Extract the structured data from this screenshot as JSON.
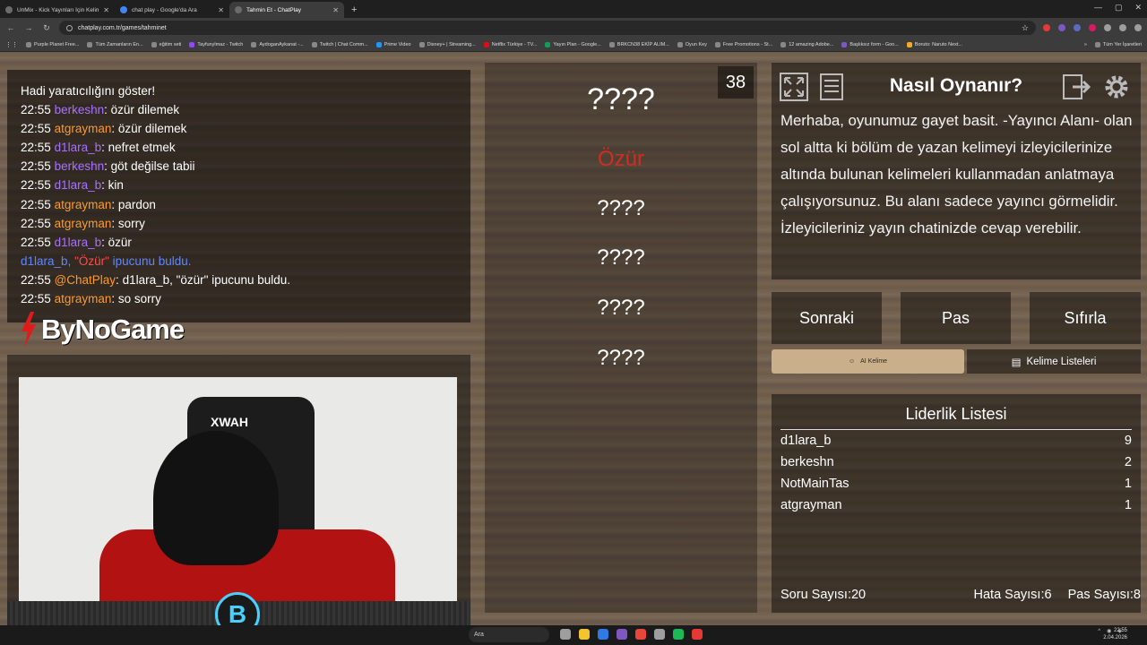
{
  "browser": {
    "tabs": [
      {
        "title": "UnMix - Kick Yayınları İçin Kelim",
        "active": false
      },
      {
        "title": "chat play - Google'da Ara",
        "active": false
      },
      {
        "title": "Tahmin Et - ChatPlay",
        "active": true
      }
    ],
    "url": "chatplay.com.tr/games/tahminet",
    "bookmarks": [
      "Purple Planet Free...",
      "Tüm Zamanların En...",
      "eğitim seti",
      "Tayfunylmaz - Twitch",
      "AydoganAykanat -...",
      "Twitch | Chat Comm...",
      "Prime Video",
      "Disney+ | Streaming...",
      "Netflix Türkiye - TV...",
      "Yayın Plan - Google...",
      "BRKCN38 EKİP ALIM...",
      "Oyun Key",
      "Free Promotions - St...",
      "12 amazing Adobe...",
      "Başlıksız form - Goo...",
      "Boruto: Naruto Next..."
    ],
    "all_bookmarks_label": "Tüm Yer İşaretleri"
  },
  "chat": {
    "lines": [
      {
        "time": "",
        "user": "",
        "sep": "",
        "text": "Hadi yaratıcılığını göster!",
        "user_color": "none",
        "type": "plain"
      },
      {
        "time": "22:55",
        "user": "berkeshn",
        "sep": ":",
        "text": "özür dilemek",
        "user_color": "purple",
        "type": "msg"
      },
      {
        "time": "22:55",
        "user": "atgrayman",
        "sep": ":",
        "text": "özür dilemek",
        "user_color": "orange",
        "type": "msg"
      },
      {
        "time": "22:55",
        "user": "d1lara_b",
        "sep": ":",
        "text": "nefret etmek",
        "user_color": "purple",
        "type": "msg"
      },
      {
        "time": "22:55",
        "user": "berkeshn",
        "sep": ":",
        "text": "göt değilse tabii",
        "user_color": "purple",
        "type": "msg"
      },
      {
        "time": "22:55",
        "user": "d1lara_b",
        "sep": ":",
        "text": "kin",
        "user_color": "purple",
        "type": "msg"
      },
      {
        "time": "22:55",
        "user": "atgrayman",
        "sep": ":",
        "text": "pardon",
        "user_color": "orange",
        "type": "msg"
      },
      {
        "time": "22:55",
        "user": "atgrayman",
        "sep": ":",
        "text": "sorry",
        "user_color": "orange",
        "type": "msg"
      },
      {
        "time": "22:55",
        "user": "d1lara_b",
        "sep": ":",
        "text": "özür",
        "user_color": "purple",
        "type": "msg"
      },
      {
        "time": "",
        "user": "",
        "sep": "",
        "text": "",
        "user_color": "none",
        "type": "hint",
        "hint_user": "d1lara_b,",
        "hint_word": "\"Özür\"",
        "hint_rest": "ipucunu buldu."
      },
      {
        "time": "22:55",
        "user": "@ChatPlay",
        "sep": ":",
        "text": "d1lara_b, \"özür\" ipucunu buldu.",
        "user_color": "orange",
        "type": "msg"
      },
      {
        "time": "22:55",
        "user": "atgrayman",
        "sep": ":",
        "text": "so sorry",
        "user_color": "orange",
        "type": "msg"
      }
    ]
  },
  "branding": {
    "logo_text": "ByNoGame",
    "chair_text": "XWAH",
    "badge_letter": "B"
  },
  "words": {
    "counter": "38",
    "items": [
      {
        "text": "????",
        "state": "hidden-main"
      },
      {
        "text": "Özür",
        "state": "found"
      },
      {
        "text": "????",
        "state": "hidden"
      },
      {
        "text": "????",
        "state": "hidden"
      },
      {
        "text": "????",
        "state": "hidden"
      },
      {
        "text": "????",
        "state": "hidden"
      }
    ]
  },
  "rules": {
    "title": "Nasıl Oynanır?",
    "body": "Merhaba, oyunumuz gayet basit. -Yayıncı Alanı- olan sol altta ki bölüm de yazan kelimeyi izleyicilerinize altında bulunan kelimeleri kullanmadan anlatmaya çalışıyorsunuz. Bu alanı sadece yayıncı görmelidir. İzleyicileriniz yayın chatinizde cevap verebilir."
  },
  "controls": {
    "next": "Sonraki",
    "pass": "Pas",
    "reset": "Sıfırla",
    "ai_word": "AI Kelime",
    "word_lists": "Kelime Listeleri"
  },
  "leaderboard": {
    "title": "Liderlik Listesi",
    "rows": [
      {
        "name": "d1lara_b",
        "score": "9"
      },
      {
        "name": "berkeshn",
        "score": "2"
      },
      {
        "name": "NotMainTas",
        "score": "1"
      },
      {
        "name": "atgrayman",
        "score": "1"
      }
    ],
    "question_count_label": "Soru Sayısı:",
    "question_count": "20",
    "error_count_label": "Hata Sayısı:",
    "error_count": "6",
    "pass_count_label": "Pas Sayısı:",
    "pass_count": "8"
  },
  "taskbar": {
    "search_placeholder": "Ara",
    "time": "22:55",
    "date": "2.04.2026"
  },
  "colors": {
    "purple_user": "#a970ff",
    "orange_user": "#ff9a2a",
    "found_word": "#d42b20",
    "hint_blue": "#5f86ff"
  }
}
